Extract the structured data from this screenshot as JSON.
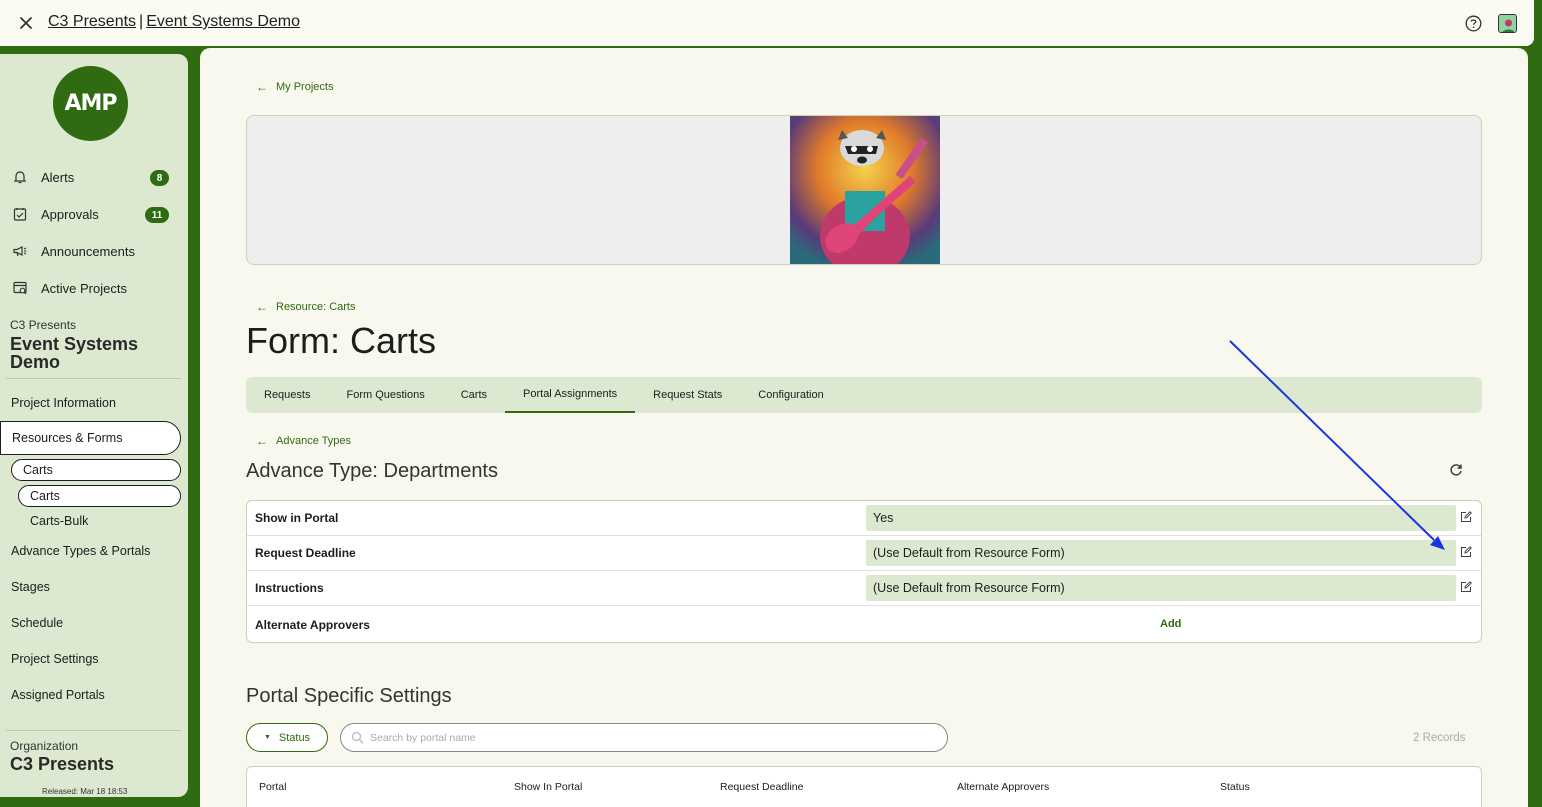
{
  "topbar": {
    "org": "C3 Presents",
    "separator": "|",
    "project": "Event Systems Demo"
  },
  "sidebar": {
    "logo_text": "AMP",
    "nav": [
      {
        "label": "Alerts",
        "badge": "8",
        "icon": "bell-icon"
      },
      {
        "label": "Approvals",
        "badge": "11",
        "icon": "calendar-check-icon"
      },
      {
        "label": "Announcements",
        "icon": "megaphone-icon"
      },
      {
        "label": "Active Projects",
        "icon": "projects-icon"
      }
    ],
    "project_org": "C3 Presents",
    "project_name_line1": "Event Systems",
    "project_name_line2": "Demo",
    "links": {
      "project_information": "Project Information",
      "resources_forms": "Resources & Forms",
      "carts_resource": "Carts",
      "carts_form": "Carts",
      "carts_bulk": "Carts-Bulk",
      "advance_types": "Advance Types & Portals",
      "stages": "Stages",
      "schedule": "Schedule",
      "project_settings": "Project Settings",
      "assigned_portals": "Assigned Portals"
    },
    "organization_label": "Organization",
    "organization_name": "C3 Presents",
    "released": "Released: Mar 18 18:53"
  },
  "main": {
    "back_my_projects": "My Projects",
    "back_resource": "Resource: Carts",
    "title": "Form: Carts",
    "tabs": [
      "Requests",
      "Form Questions",
      "Carts",
      "Portal Assignments",
      "Request Stats",
      "Configuration"
    ],
    "active_tab": "Portal Assignments",
    "back_advance_types": "Advance Types",
    "section_title": "Advance Type: Departments",
    "details": [
      {
        "label": "Show in Portal",
        "value": "Yes"
      },
      {
        "label": "Request Deadline",
        "value": "(Use Default from Resource Form)"
      },
      {
        "label": "Instructions",
        "value": "(Use Default from Resource Form)"
      },
      {
        "label": "Alternate Approvers",
        "action": "Add"
      }
    ],
    "portal_settings_title": "Portal Specific Settings",
    "status_button": "Status",
    "search_placeholder": "Search by portal name",
    "records": "2 Records",
    "table_headers": [
      "Portal",
      "Show In Portal",
      "Request Deadline",
      "Alternate Approvers",
      "Status"
    ]
  },
  "colors": {
    "brand_green": "#2f6b10",
    "sidebar_bg": "#dce8cf",
    "annotation_arrow": "#1a35e0"
  }
}
